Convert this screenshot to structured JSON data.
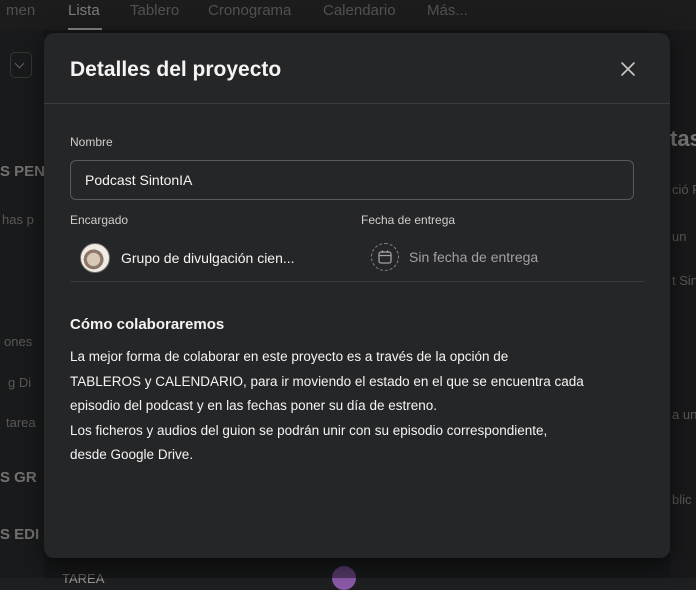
{
  "background": {
    "tabs": [
      "Lista",
      "Tablero",
      "Cronograma",
      "Calendario",
      "Más..."
    ],
    "left_fragments": [
      "S PEN",
      "has p",
      "ones",
      "g Di",
      "tarea",
      "S GR",
      "S EDI"
    ],
    "right_fragments": [
      "tas",
      "ció F",
      "un",
      "t Sin",
      "a un",
      "blic"
    ],
    "bottom_fragment": "TAREA"
  },
  "dialog": {
    "title": "Detalles del proyecto",
    "name_label": "Nombre",
    "name_value": "Podcast SintonIA",
    "assignee_label": "Encargado",
    "assignee_name": "Grupo de divulgación cien...",
    "due_label": "Fecha de entrega",
    "due_value": "Sin fecha de entrega",
    "section_title": "Cómo colaboraremos",
    "description_lines": [
      "La mejor forma de colaborar en este proyecto es a través de la opción de",
      "TABLEROS y CALENDARIO, para ir moviendo el estado en el que se encuentra cada",
      "episodio del podcast y en las fechas poner su día de estreno.",
      "Los ficheros y audios del guion se podrán unir con su episodio correspondiente,",
      "desde Google Drive."
    ]
  },
  "icons": {
    "close": "close-icon",
    "calendar": "calendar-icon"
  }
}
